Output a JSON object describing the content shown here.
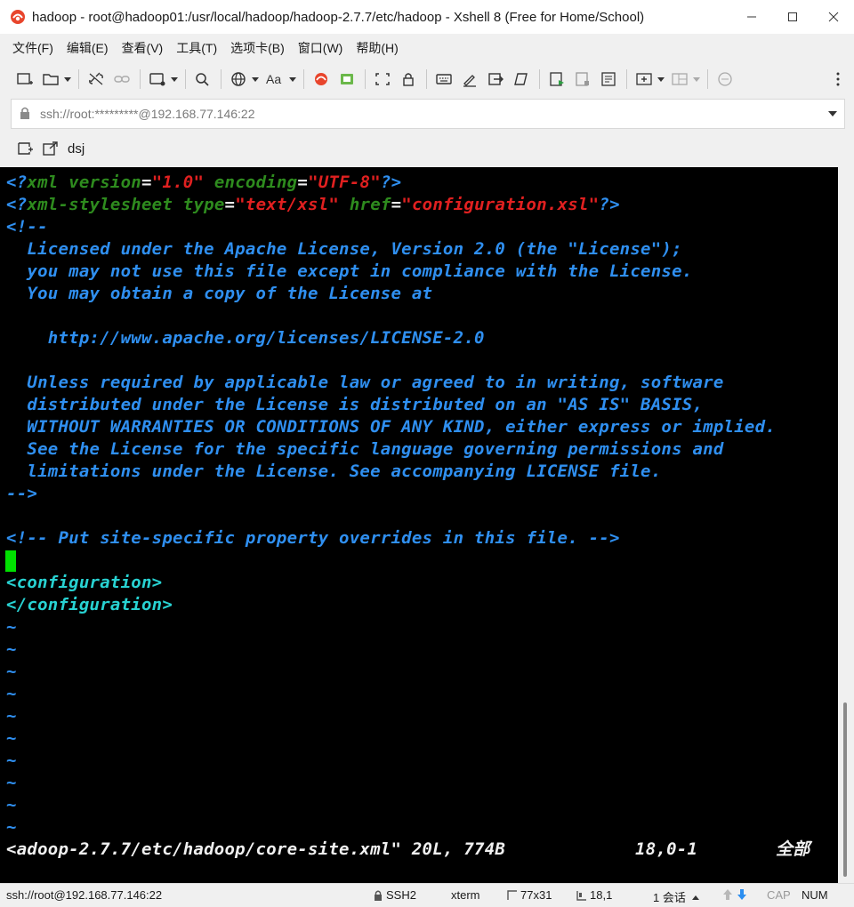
{
  "window": {
    "title": "hadoop - root@hadoop01:/usr/local/hadoop/hadoop-2.7.7/etc/hadoop - Xshell 8 (Free for Home/School)"
  },
  "menu": {
    "items": [
      "文件(F)",
      "编辑(E)",
      "查看(V)",
      "工具(T)",
      "选项卡(B)",
      "窗口(W)",
      "帮助(H)"
    ]
  },
  "address": {
    "value": "ssh://root:*********@192.168.77.146:22"
  },
  "tab": {
    "label": "dsj"
  },
  "terminal": {
    "xml_decl": {
      "open": "<?",
      "name": "xml",
      "attr1": "version",
      "eq": "=",
      "val1": "\"1.0\"",
      "attr2": "encoding",
      "val2": "\"UTF-8\"",
      "close": "?>"
    },
    "stylesheet_decl": {
      "open": "<?",
      "name": "xml-stylesheet",
      "attr1": "type",
      "eq": "=",
      "val1": "\"text/xsl\"",
      "attr2": "href",
      "val2": "\"configuration.xsl\"",
      "close": "?>"
    },
    "comment_lines": [
      "<!--",
      "  Licensed under the Apache License, Version 2.0 (the \"License\");",
      "  you may not use this file except in compliance with the License.",
      "  You may obtain a copy of the License at",
      "",
      "    http://www.apache.org/licenses/LICENSE-2.0",
      "",
      "  Unless required by applicable law or agreed to in writing, software",
      "  distributed under the License is distributed on an \"AS IS\" BASIS,",
      "  WITHOUT WARRANTIES OR CONDITIONS OF ANY KIND, either express or implied.",
      "  See the License for the specific language governing permissions and",
      "  limitations under the License. See accompanying LICENSE file.",
      "-->",
      "",
      "<!-- Put site-specific property overrides in this file. -->"
    ],
    "config_open": "<configuration>",
    "config_close": "</configuration>",
    "tilde_lines": [
      "~",
      "~",
      "~",
      "~",
      "~",
      "~",
      "~",
      "~",
      "~",
      "~"
    ],
    "status": {
      "file": "<adoop-2.7.7/etc/hadoop/core-site.xml\" 20L, 774B",
      "position": "18,0-1",
      "scroll": "全部"
    }
  },
  "statusbar": {
    "connection": "ssh://root@192.168.77.146:22",
    "protocol": "SSH2",
    "terminal_type": "xterm",
    "size": "77x31",
    "cursor": "18,1",
    "sessions": "1 会话",
    "cap": "CAP",
    "num": "NUM"
  },
  "colors": {
    "comment": "#2f8ff0",
    "keyword": "#2e8b1e",
    "string": "#e02020",
    "tag": "#28d2d2",
    "cursor": "#00e000",
    "terminal_bg": "#000000"
  }
}
